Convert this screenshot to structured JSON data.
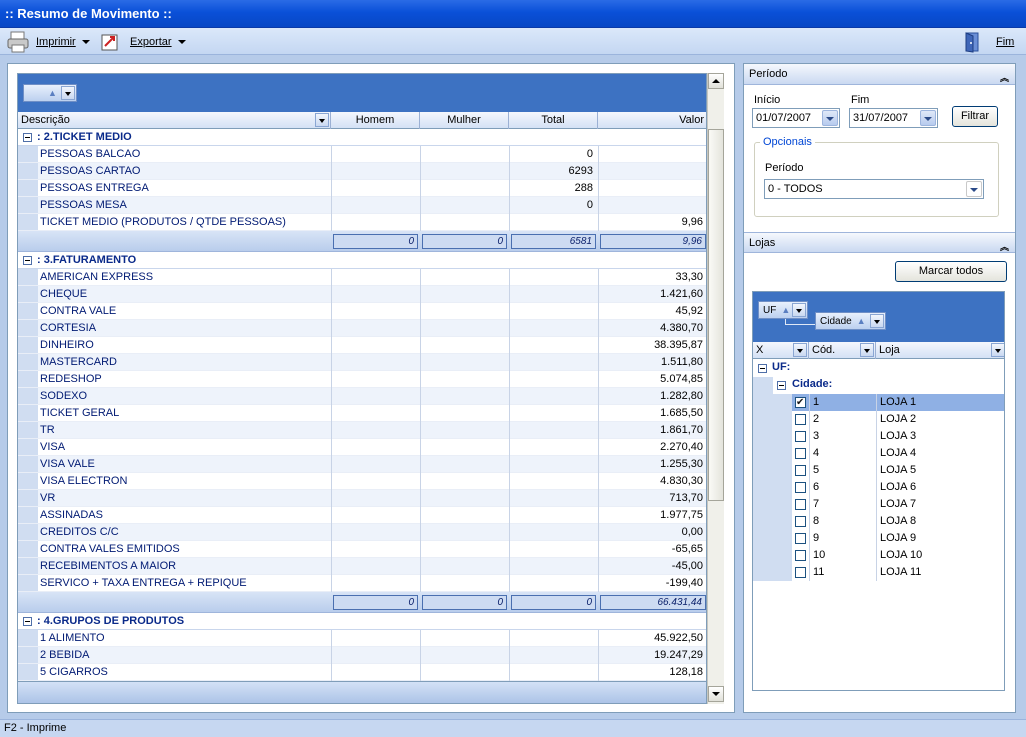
{
  "window": {
    "title": ":: Resumo de Movimento ::"
  },
  "toolbar": {
    "print_label": "Imprimir",
    "export_label": "Exportar",
    "exit_label": "Fim"
  },
  "grid": {
    "columns": [
      "Descrição",
      "Homem",
      "Mulher",
      "Total",
      "Valor"
    ],
    "groups": [
      {
        "title": ": 2.TICKET MEDIO",
        "rows": [
          {
            "desc": "PESSOAS BALCAO",
            "homem": "",
            "mulher": "",
            "total": "0",
            "valor": ""
          },
          {
            "desc": "PESSOAS CARTAO",
            "homem": "",
            "mulher": "",
            "total": "6293",
            "valor": ""
          },
          {
            "desc": "PESSOAS ENTREGA",
            "homem": "",
            "mulher": "",
            "total": "288",
            "valor": ""
          },
          {
            "desc": "PESSOAS MESA",
            "homem": "",
            "mulher": "",
            "total": "0",
            "valor": ""
          },
          {
            "desc": "TICKET MEDIO (PRODUTOS / QTDE PESSOAS)",
            "homem": "",
            "mulher": "",
            "total": "",
            "valor": "9,96"
          }
        ],
        "footer": {
          "homem": "0",
          "mulher": "0",
          "total": "6581",
          "valor": "9,96"
        }
      },
      {
        "title": ": 3.FATURAMENTO",
        "rows": [
          {
            "desc": "AMERICAN EXPRESS",
            "valor": "33,30"
          },
          {
            "desc": "CHEQUE",
            "valor": "1.421,60"
          },
          {
            "desc": "CONTRA VALE",
            "valor": "45,92"
          },
          {
            "desc": "CORTESIA",
            "valor": "4.380,70"
          },
          {
            "desc": "DINHEIRO",
            "valor": "38.395,87"
          },
          {
            "desc": "MASTERCARD",
            "valor": "1.511,80"
          },
          {
            "desc": "REDESHOP",
            "valor": "5.074,85"
          },
          {
            "desc": "SODEXO",
            "valor": "1.282,80"
          },
          {
            "desc": "TICKET GERAL",
            "valor": "1.685,50"
          },
          {
            "desc": "TR",
            "valor": "1.861,70"
          },
          {
            "desc": "VISA",
            "valor": "2.270,40"
          },
          {
            "desc": "VISA  VALE",
            "valor": "1.255,30"
          },
          {
            "desc": "VISA ELECTRON",
            "valor": "4.830,30"
          },
          {
            "desc": "VR",
            "valor": "713,70"
          },
          {
            "desc": "ASSINADAS",
            "valor": "1.977,75"
          },
          {
            "desc": "CREDITOS C/C",
            "valor": "0,00"
          },
          {
            "desc": "CONTRA VALES EMITIDOS",
            "valor": "-65,65"
          },
          {
            "desc": "RECEBIMENTOS A MAIOR",
            "valor": "-45,00"
          },
          {
            "desc": "SERVICO + TAXA ENTREGA + REPIQUE",
            "valor": "-199,40"
          }
        ],
        "footer": {
          "homem": "0",
          "mulher": "0",
          "total": "0",
          "valor": "66.431,44"
        }
      },
      {
        "title": ": 4.GRUPOS DE PRODUTOS",
        "rows": [
          {
            "desc": "1 ALIMENTO",
            "valor": "45.922,50"
          },
          {
            "desc": "2 BEBIDA",
            "valor": "19.247,29"
          },
          {
            "desc": "5 CIGARROS",
            "valor": "128,18"
          }
        ]
      }
    ]
  },
  "periodo": {
    "header": "Período",
    "inicio_label": "Início",
    "inicio_value": "01/07/2007",
    "fim_label": "Fim",
    "fim_value": "31/07/2007",
    "filter_button": "Filtrar",
    "opcionais_legend": "Opcionais",
    "periodo_label": "Período",
    "periodo_value": "0 - TODOS"
  },
  "lojas": {
    "header": "Lojas",
    "mark_all_button": "Marcar todos",
    "group_uf": "UF",
    "group_cidade": "Cidade",
    "columns": [
      "X",
      "Cód.",
      "Loja"
    ],
    "uf_label": "UF:",
    "cidade_label": "Cidade:",
    "rows": [
      {
        "cod": "1",
        "loja": "LOJA 1",
        "checked": true
      },
      {
        "cod": "2",
        "loja": "LOJA 2",
        "checked": false
      },
      {
        "cod": "3",
        "loja": "LOJA 3",
        "checked": false
      },
      {
        "cod": "4",
        "loja": "LOJA 4",
        "checked": false
      },
      {
        "cod": "5",
        "loja": "LOJA 5",
        "checked": false
      },
      {
        "cod": "6",
        "loja": "LOJA 6",
        "checked": false
      },
      {
        "cod": "7",
        "loja": "LOJA 7",
        "checked": false
      },
      {
        "cod": "8",
        "loja": "LOJA 8",
        "checked": false
      },
      {
        "cod": "9",
        "loja": "LOJA 9",
        "checked": false
      },
      {
        "cod": "10",
        "loja": "LOJA 10",
        "checked": false
      },
      {
        "cod": "11",
        "loja": "LOJA 11",
        "checked": false
      }
    ]
  },
  "status": {
    "text": "F2 - Imprime"
  }
}
